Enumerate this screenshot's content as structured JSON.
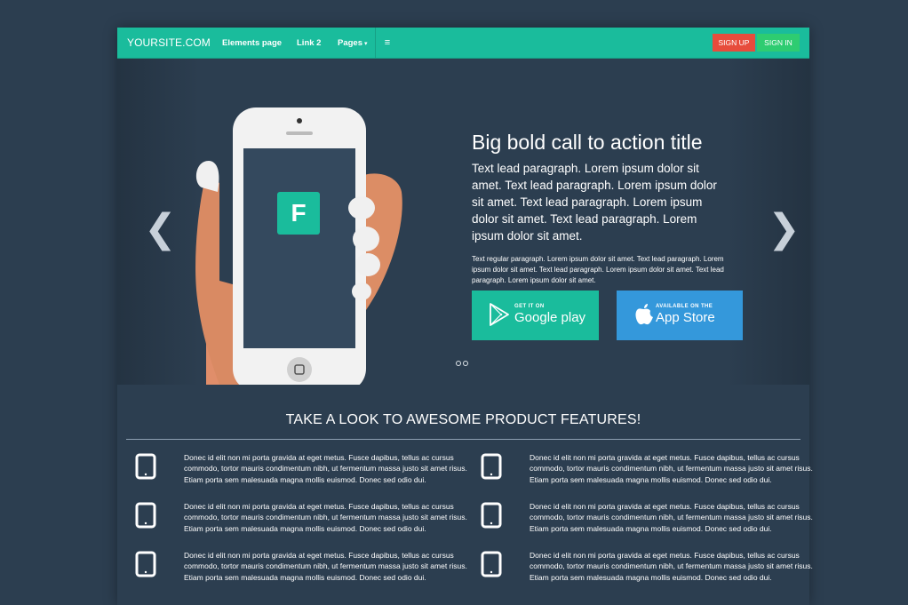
{
  "navbar": {
    "brand": "YOURSITE.COM",
    "links": [
      "Elements page",
      "Link 2",
      "Pages"
    ],
    "signup_label": "SIGN UP",
    "signin_label": "SIGN IN"
  },
  "hero": {
    "title": "Big bold call to action title",
    "lead": "Text lead paragraph. Lorem ipsum dolor sit amet. Text lead paragraph. Lorem ipsum dolor sit amet. Text lead paragraph. Lorem ipsum dolor sit amet. Text lead paragraph. Lorem ipsum dolor sit amet.",
    "small": "Text regular paragraph. Lorem ipsum dolor sit amet. Text lead paragraph. Lorem ipsum dolor sit amet. Text lead paragraph. Lorem ipsum dolor sit amet. Text lead paragraph. Lorem ipsum dolor sit amet.",
    "app_letter": "F",
    "google_small": "GET IT ON",
    "google_big": "Google play",
    "apple_small": "AVAILABLE ON THE",
    "apple_big": "App Store"
  },
  "features": {
    "title": "TAKE A LOOK TO AWESOME PRODUCT FEATURES!",
    "text": "Donec id elit non mi porta gravida at eget metus. Fusce dapibus, tellus ac cursus commodo, tortor mauris condimentum nibh, ut fermentum massa justo sit amet risus. Etiam porta sem malesuada magna mollis euismod. Donec sed odio dui."
  },
  "colors": {
    "background": "#2c3e50",
    "accent": "#1abc9c",
    "signup": "#e74c3c",
    "signin": "#2ecc71",
    "apple": "#3498db"
  },
  "icons": {
    "menu": "hamburger-icon",
    "feature": "tablet-icon",
    "google": "google-play-icon",
    "apple": "apple-icon"
  }
}
